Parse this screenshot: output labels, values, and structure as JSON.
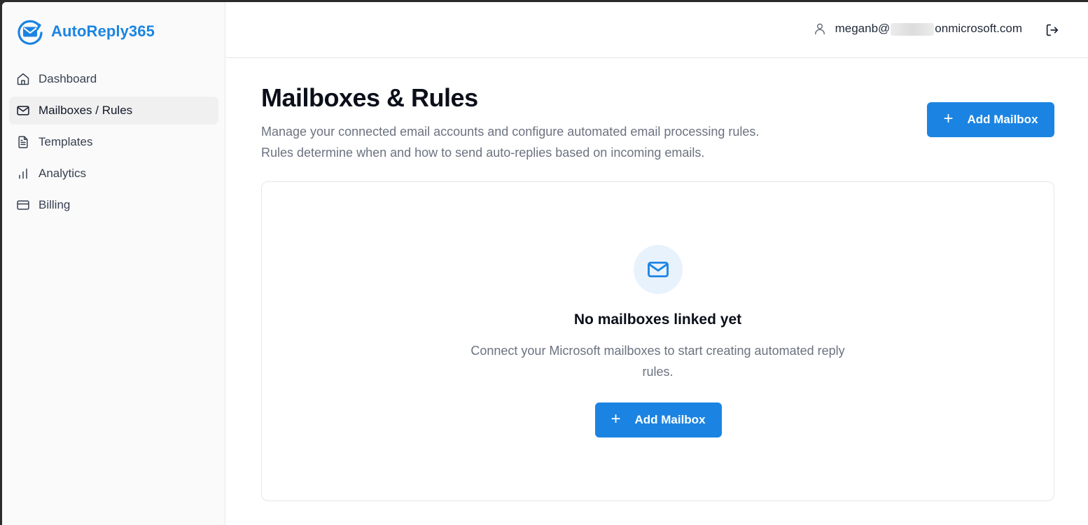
{
  "app": {
    "name": "AutoReply365"
  },
  "sidebar": {
    "items": [
      {
        "label": "Dashboard",
        "icon": "home-icon",
        "active": false
      },
      {
        "label": "Mailboxes / Rules",
        "icon": "mail-icon",
        "active": true
      },
      {
        "label": "Templates",
        "icon": "document-icon",
        "active": false
      },
      {
        "label": "Analytics",
        "icon": "bar-chart-icon",
        "active": false
      },
      {
        "label": "Billing",
        "icon": "credit-card-icon",
        "active": false
      }
    ]
  },
  "header": {
    "user_prefix": "meganb@",
    "user_suffix": "onmicrosoft.com",
    "user_icon": "user-icon",
    "logout_icon": "logout-icon"
  },
  "main": {
    "title": "Mailboxes & Rules",
    "description_line1": "Manage your connected email accounts and configure automated email processing rules.",
    "description_line2": "Rules determine when and how to send auto-replies based on incoming emails.",
    "add_button_label": "Add Mailbox",
    "empty_state": {
      "icon": "mail-icon",
      "title": "No mailboxes linked yet",
      "description": "Connect your Microsoft mailboxes to start creating automated reply rules.",
      "button_label": "Add Mailbox"
    }
  },
  "colors": {
    "accent": "#1b84e2",
    "icon_bg": "#e8f2fc"
  }
}
